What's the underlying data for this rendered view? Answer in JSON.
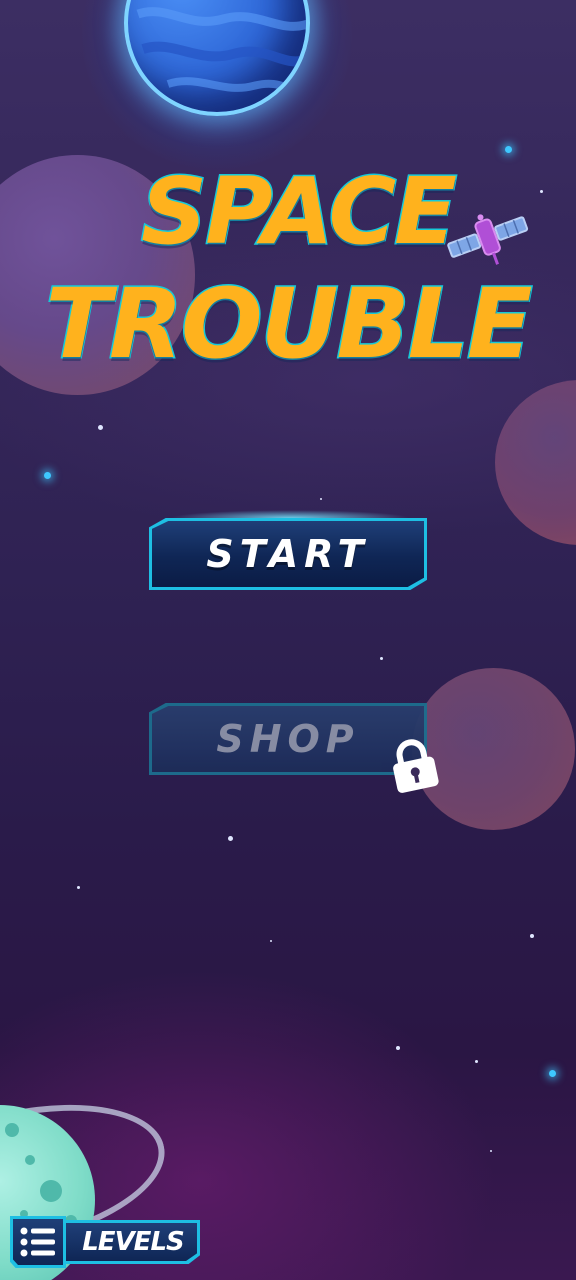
{
  "game": {
    "title_line1": "SPACE",
    "title_line2": "TROUBLE"
  },
  "menu": {
    "start_label": "START",
    "shop_label": "SHOP",
    "shop_locked": true
  },
  "footer": {
    "levels_label": "LEVELS"
  },
  "icons": {
    "levels": "list-icon",
    "lock": "lock-icon",
    "satellite": "satellite-icon"
  },
  "colors": {
    "title_fill": "#ffb21d",
    "title_stroke": "#16c9d8",
    "button_border": "#1ebfe3",
    "button_fill": "#0f2655",
    "disabled_text": "#8d93a8"
  }
}
